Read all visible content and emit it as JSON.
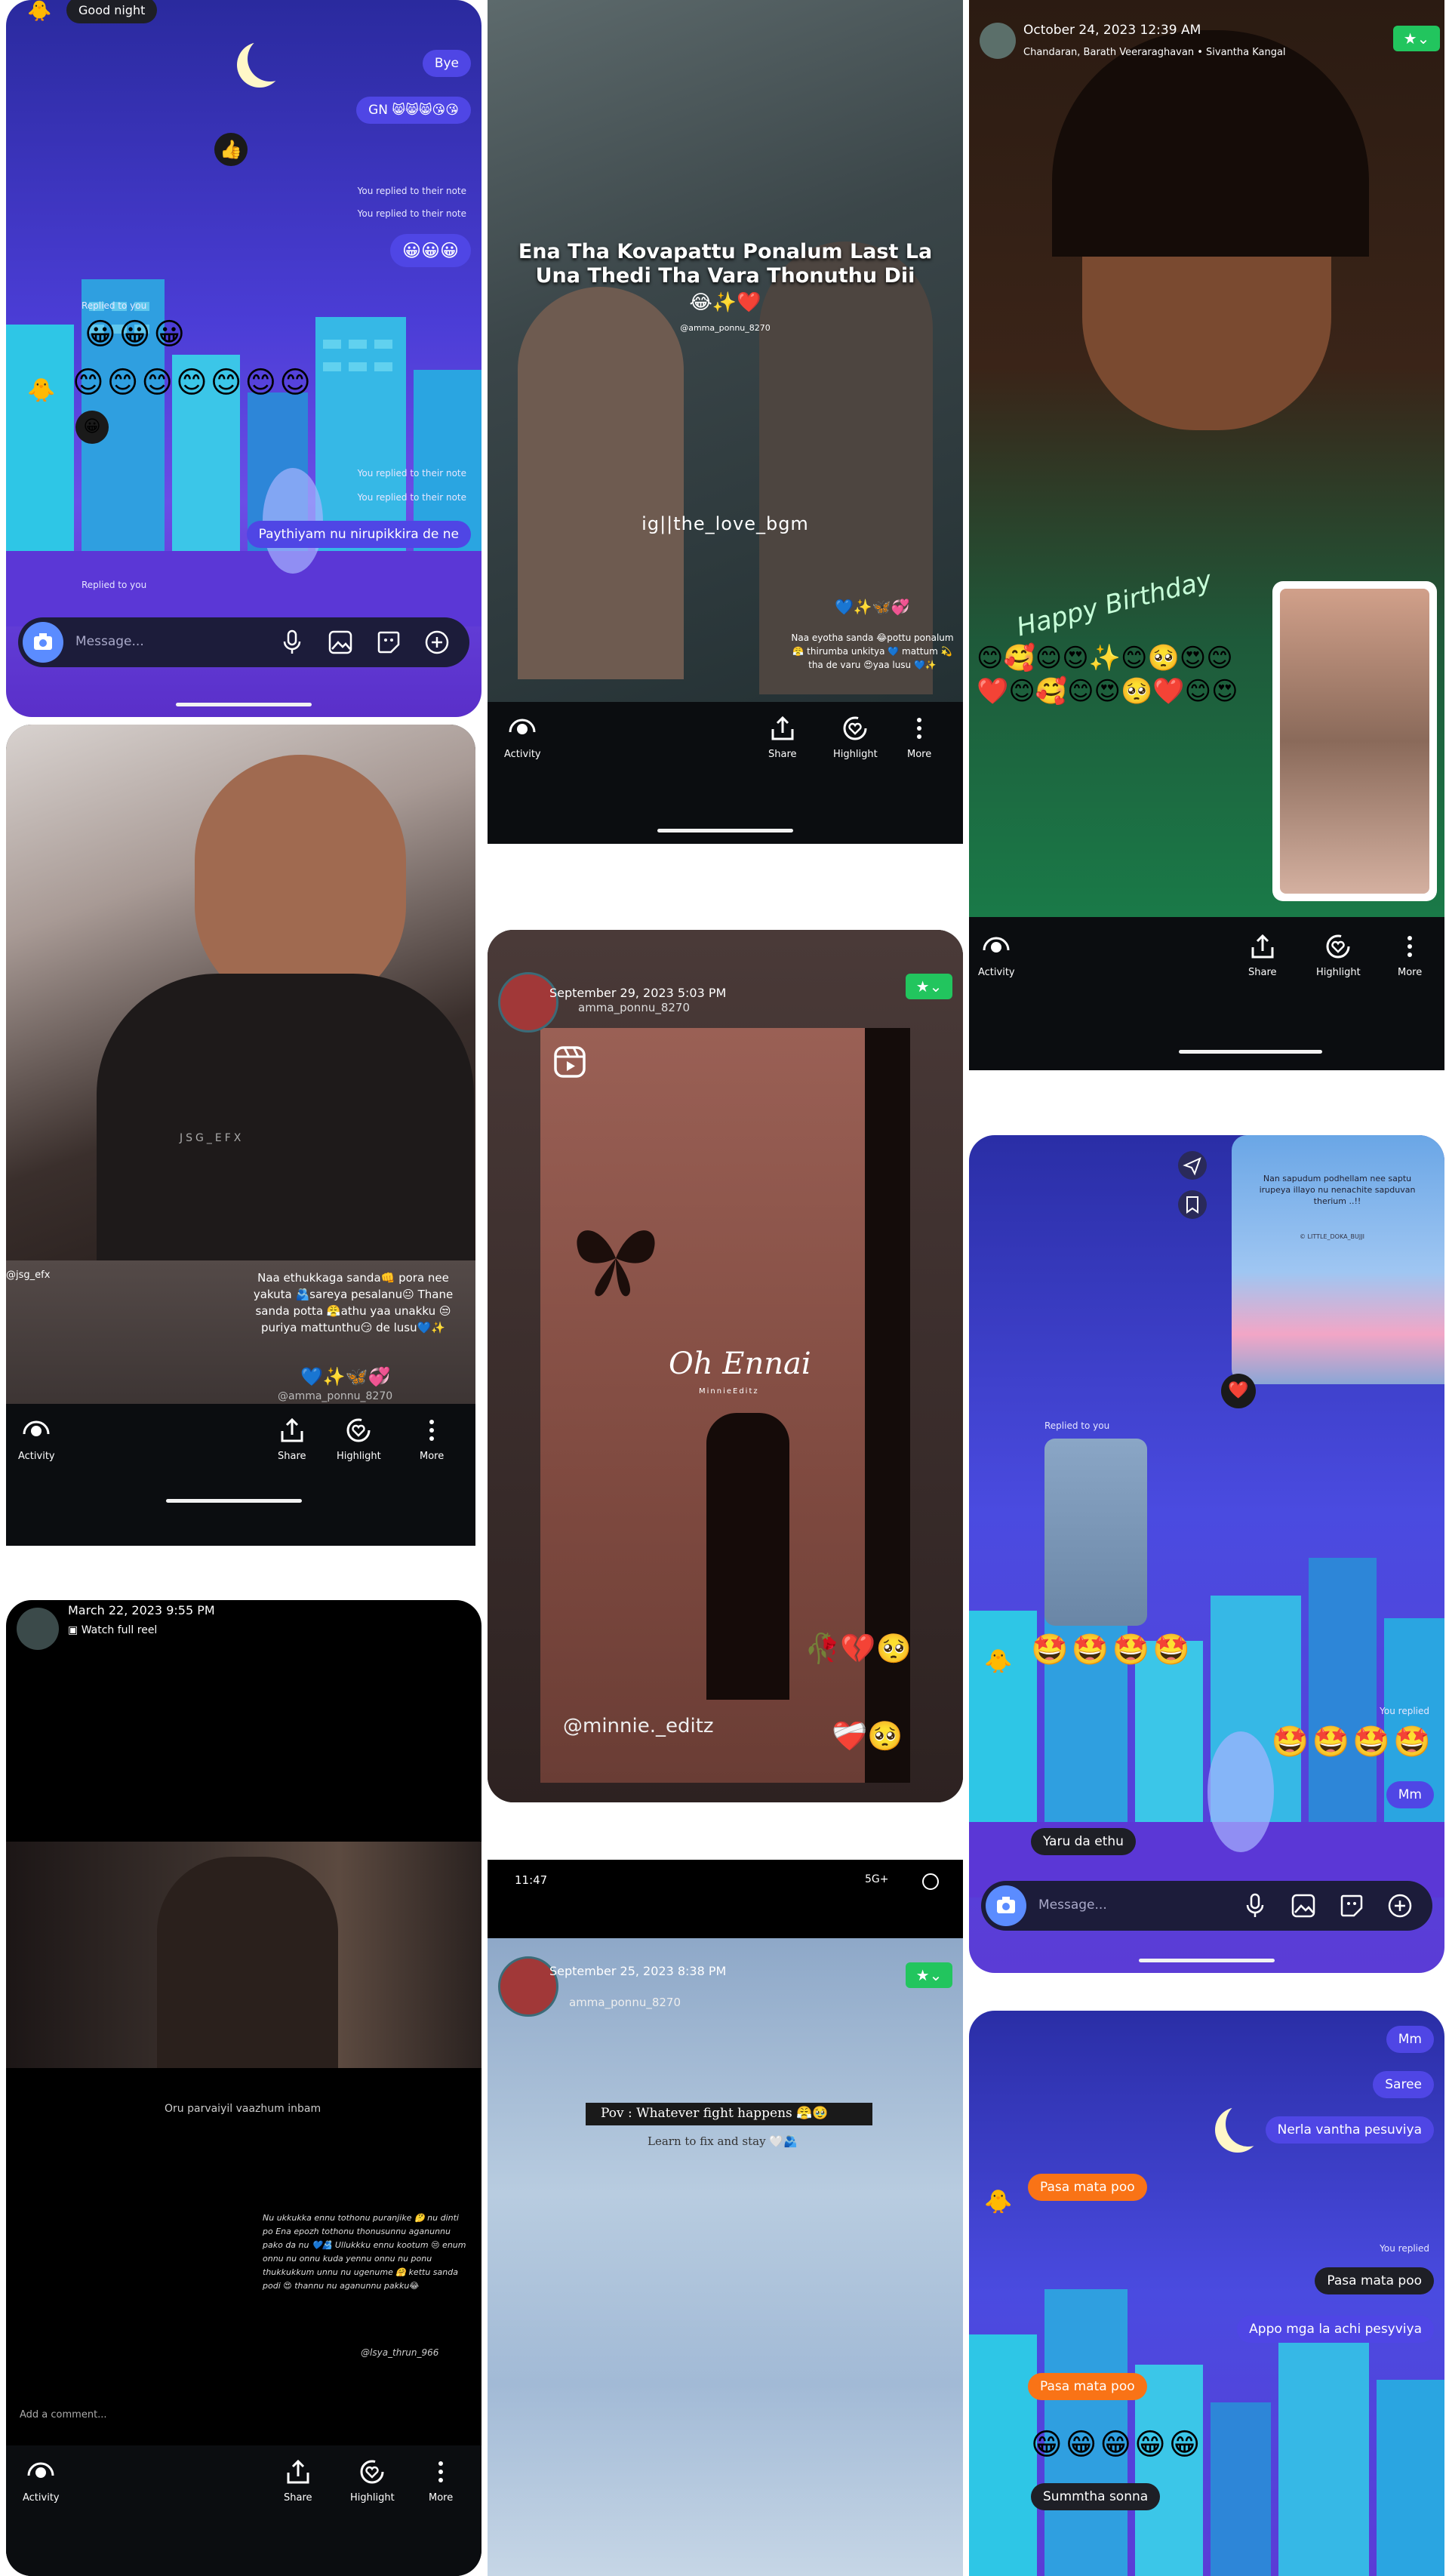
{
  "tile1": {
    "title": "Good night",
    "msgs": {
      "bye": "Bye",
      "gn": "GN 😸😸😸😘😘",
      "replied_note1": "You replied to their note",
      "replied_note2": "You replied to their note",
      "grin_row": "😀😀😀",
      "replied_to_you": "Replied to you",
      "emoji_row3": "😀😀😀",
      "emoji_row7": "😊😊😊😊😊😊😊",
      "replied_note3": "You replied to their note",
      "replied_note4": "You replied to their note",
      "paythiyam": "Paythiyam nu nirupikkira de ne",
      "replied_to_you2": "Replied to you"
    },
    "composer_placeholder": "Message..."
  },
  "tile2": {
    "caption_main": "Ena Tha Kovapattu Ponalum Last La Una Thedi Tha Vara Thonuthu Dii",
    "caption_emoji": "😂✨❤️",
    "credit_small": "@amma_ponnu_8270",
    "watermark": "ig||the_love_bgm",
    "side_emoji": "💙✨🦋💞",
    "side_text": "Naa eyotha sanda 😂pottu ponalum😤 thirumba unkitya 💙 mattum 💫tha de varu 😍yaa lusu 💙✨",
    "actions": [
      "Activity",
      "Share",
      "Highlight",
      "More"
    ]
  },
  "tile3": {
    "date": "October 24, 2023 12:39 AM",
    "music": "Chandaran, Barath Veeraraghavan • Sivantha Kangal",
    "overlay_text": "Happy Birthday",
    "actions": [
      "Activity",
      "Share",
      "Highlight",
      "More"
    ]
  },
  "tile4": {
    "credit": "@jsg_efx",
    "watermark": "JSG_EFX",
    "caption": "Naa ethukkaga sanda👊 pora nee yakuta 🫂sareya pesalanu😐 Thane sanda potta 😤athu yaa unakku 😒puriya mattunthu😏 de lusu💙✨",
    "caption_emoji": "💙✨🦋💞",
    "handle": "@amma_ponnu_8270",
    "actions": [
      "Activity",
      "Share",
      "Highlight",
      "More"
    ]
  },
  "tile5": {
    "date": "September 29, 2023 5:03 PM",
    "username": "amma_ponnu_8270",
    "center_text": "Oh Ennai",
    "sub_text": "MinnieEditz",
    "emoji1": "🥀💔🥺",
    "handle": "@minnie._editz",
    "emoji2": "❤️‍🩹🥺"
  },
  "tile6": {
    "preview_text": "Nan sapudum podhellam nee saptu irupeya illayo nu nenachite sapduvan therium ..!!",
    "preview_credit": "© LITTLE_DOKA_BUJJI",
    "replied_to_you": "Replied to you",
    "heart": "❤️",
    "emoji_row1": "🤩🤩🤩🤩",
    "you_replied": "You replied",
    "emoji_row2": "🤩🤩🤩🤩",
    "mm": "Mm",
    "yaru": "Yaru da ethu",
    "composer_placeholder": "Message..."
  },
  "tile7": {
    "date": "March 22, 2023 9:55 PM",
    "watch": "Watch full reel",
    "subtitle": "Oru parvaiyil vaazhum inbam",
    "poem": "Nu ukkukka ennu tothonu puranjike 🤔 nu dinti po Ena epozh tothonu thonusunnu aganunnu pako da nu 💙🫂 Ullukkku ennu kootum 😒 enum onnu nu onnu kuda yennu onnu nu ponu thukkukkum unnu nu ugenume 🤗 kettu sanda podi 😍 thannu nu aganunnu pakku😂",
    "credit": "@lsya_thrun_966",
    "comment": "Add a comment...",
    "actions": [
      "Activity",
      "Share",
      "Highlight",
      "More"
    ]
  },
  "tile8": {
    "status_time": "11:47",
    "status_right": "5G+",
    "date": "September 25, 2023 8:38 PM",
    "username": "amma_ponnu_8270",
    "quote1": "Pov : Whatever fight happens 😤🥹",
    "quote2": "Learn to fix and stay 🤍🫂"
  },
  "tile9": {
    "mm": "Mm",
    "saree": "Saree",
    "nerla": "Nerla vantha pesuviya",
    "pasa1": "Pasa mata poo",
    "you_replied": "You replied",
    "pasa2": "Pasa mata poo",
    "appo": "Appo mga la achi pesyviya",
    "pasa3": "Pasa mata poo",
    "grins": "😁😁😁😁😁",
    "summ": "Summtha sonna"
  }
}
